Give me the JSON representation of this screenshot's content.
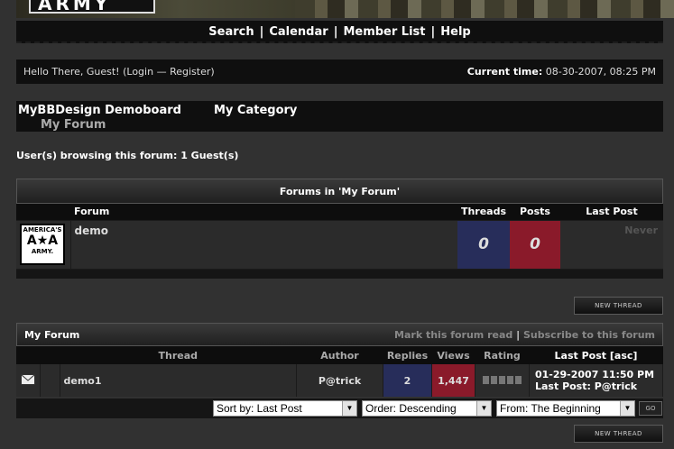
{
  "banner": {
    "logo_text": "ARMY"
  },
  "nav": {
    "items": [
      "Search",
      "Calendar",
      "Member List",
      "Help"
    ],
    "separator": "|"
  },
  "welcome": {
    "greeting": "Hello There, Guest! (",
    "login": "Login",
    "dash": " — ",
    "register": "Register",
    "close": ")",
    "time_label": "Current time:",
    "time_value": "08-30-2007, 08:25 PM"
  },
  "breadcrumb": {
    "board": "MyBBDesign Demoboard",
    "category": "My Category",
    "forum": "My Forum"
  },
  "browsing": "User(s) browsing this forum: 1 Guest(s)",
  "forums_table": {
    "title": "Forums in 'My Forum'",
    "headers": {
      "forum": "Forum",
      "threads": "Threads",
      "posts": "Posts",
      "last_post": "Last Post"
    },
    "rows": [
      {
        "logo_top": "AMERICA'S",
        "logo_mid": "A★A",
        "logo_bottom": "ARMY.",
        "name": "demo",
        "threads": "0",
        "posts": "0",
        "last_post": "Never"
      }
    ]
  },
  "new_thread_label": "NEW THREAD",
  "thread_list": {
    "title": "My Forum",
    "mark_read": "Mark this forum read",
    "sep": "|",
    "subscribe": "Subscribe to this forum",
    "headers": {
      "thread": "Thread",
      "author": "Author",
      "replies": "Replies",
      "views": "Views",
      "rating": "Rating",
      "last_post": "Last Post",
      "sort": "[asc]"
    },
    "rows": [
      {
        "title": "demo1",
        "author": "P@trick",
        "replies": "2",
        "views": "1,447",
        "rating": 0,
        "last_date": "01-29-2007 11:50 PM",
        "last_by": "Last Post: P@trick"
      }
    ]
  },
  "sort": {
    "sort_by": "Sort by: Last Post",
    "order": "Order: Descending",
    "from": "From: The Beginning",
    "go": "GO"
  },
  "colors": {
    "threads_cell": "#272d5a",
    "posts_cell": "#8a1a2a",
    "replies_cell": "#272d5a",
    "views_cell": "#8a1a2a"
  }
}
